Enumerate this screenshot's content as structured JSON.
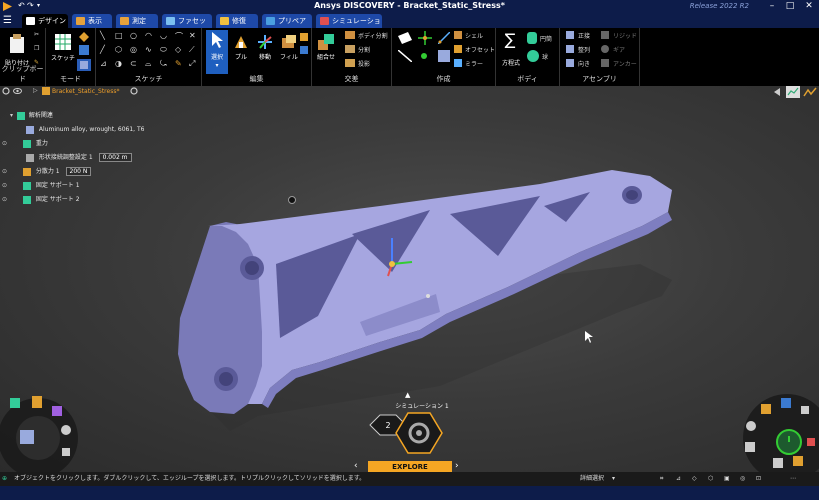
{
  "app": {
    "title": "Ansys DISCOVERY - Bracket_Static_Stress*",
    "release": "Release 2022 R2"
  },
  "tabs": [
    {
      "label": "デザイン",
      "color": "#ffffff"
    },
    {
      "label": "表示",
      "color": "#e6a23c"
    },
    {
      "label": "測定",
      "color": "#e6a23c"
    },
    {
      "label": "ファセット",
      "color": "#7bc0f0"
    },
    {
      "label": "修復",
      "color": "#f0c040"
    },
    {
      "label": "プリペア",
      "color": "#4aa0e0"
    },
    {
      "label": "シミュレーション",
      "color": "#e05050"
    }
  ],
  "ribbon": {
    "clipboard": {
      "paste": "貼り付け",
      "label": "クリップボード"
    },
    "mode": {
      "sketch": "スケッチ",
      "label": "モード"
    },
    "sketch": {
      "label": "スケッチ"
    },
    "edit": {
      "select": "選択",
      "pull": "プル",
      "move": "移動",
      "fill": "フィル",
      "label": "編集"
    },
    "intersect": {
      "combine": "組合せ",
      "split_body": "ボディ分割",
      "split": "分割",
      "project": "投影",
      "label": "交差"
    },
    "create": {
      "shell": "シェル",
      "offset": "オフセット",
      "mirror": "ミラー",
      "label": "作成"
    },
    "body": {
      "equation": "方程式",
      "cylinder": "円筒",
      "sphere": "球",
      "label": "ボディ"
    },
    "assembly": {
      "align": "正接",
      "orient": "整列",
      "direction": "向き",
      "rigid": "リジッド",
      "gear": "ギア",
      "anchor": "アンカー",
      "label": "アセンブリ"
    }
  },
  "viewport": {
    "breadcrumb": "Bracket_Static_Stress*",
    "tree": {
      "root": "解析関連",
      "material": "Aluminum alloy, wrought, 6061, T6",
      "gravity": "重力",
      "contact": "形状接続調整設定 1",
      "contact_value": "0.002 m",
      "force": "分散力 1",
      "force_value": "200 N",
      "support1": "固定 サポート 1",
      "support2": "固定 サポート 2"
    },
    "sim_label": "シミュレーション 1",
    "sim_count": "2",
    "explore": "EXPLORE"
  },
  "status": {
    "hint": "オブジェクトをクリックします。ダブルクリックして、エッジループを選択します。トリプルクリックしてソリッドを選択します。",
    "selection": "詳細選択"
  },
  "colors": {
    "title_bg": "#0d1c4a",
    "tab_bg": "#1e49a8",
    "part": "#9c9cd8",
    "accent": "#f5a623"
  }
}
